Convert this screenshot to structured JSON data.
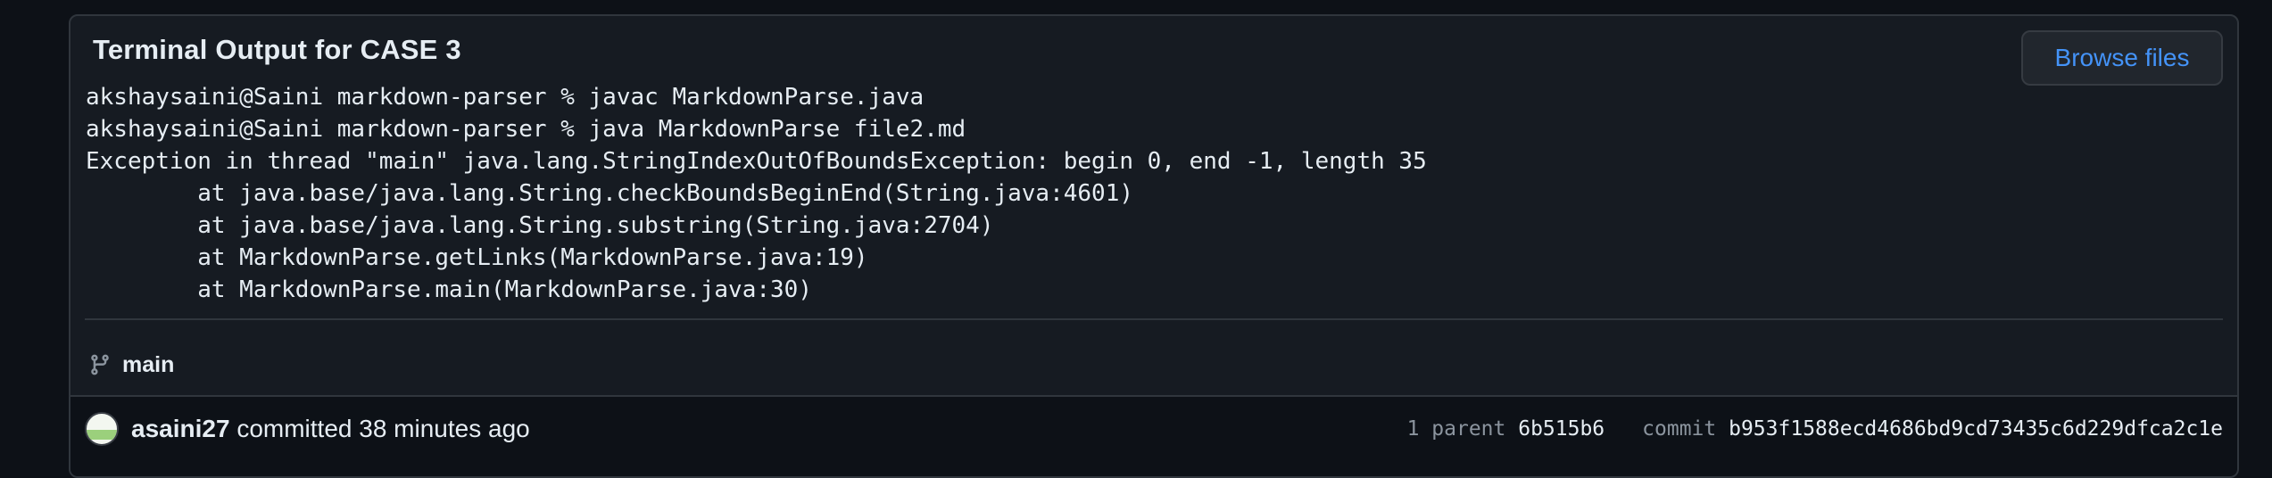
{
  "card": {
    "title": "Terminal Output for CASE 3",
    "browse_files_label": "Browse files"
  },
  "terminal": {
    "lines": [
      "akshaysaini@Saini markdown-parser % javac MarkdownParse.java",
      "akshaysaini@Saini markdown-parser % java MarkdownParse file2.md",
      "Exception in thread \"main\" java.lang.StringIndexOutOfBoundsException: begin 0, end -1, length 35",
      "        at java.base/java.lang.String.checkBoundsBeginEnd(String.java:4601)",
      "        at java.base/java.lang.String.substring(String.java:2704)",
      "        at MarkdownParse.getLinks(MarkdownParse.java:19)",
      "        at MarkdownParse.main(MarkdownParse.java:30)"
    ]
  },
  "branch": {
    "icon": "git-branch-icon",
    "name": "main"
  },
  "commit": {
    "author": "asaini27",
    "action": "committed",
    "time": "38 minutes ago",
    "parent_label": "1 parent",
    "parent_sha": "6b515b6",
    "commit_label": "commit",
    "commit_sha": "b953f1588ecd4686bd9cd73435c6d229dfca2c1e"
  },
  "colors": {
    "page_bg": "#0d1117",
    "card_bg": "#161b22",
    "border": "#30363d",
    "link": "#4493f8",
    "muted": "#8b949e",
    "text": "#e6edf3"
  }
}
